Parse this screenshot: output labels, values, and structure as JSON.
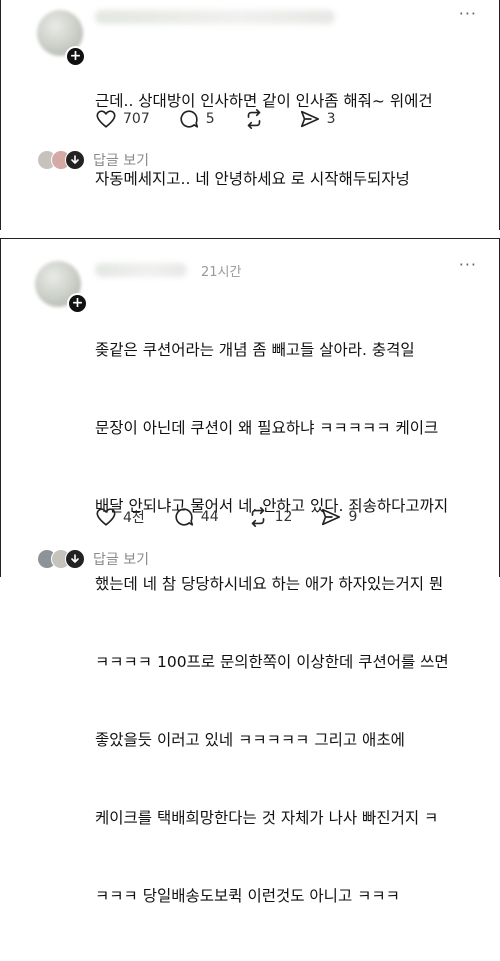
{
  "comments": [
    {
      "timestamp": "",
      "text_lines": [
        "근데.. 상대방이 인사하면 같이 인사좀 해줘~ 위에건",
        "자동메세지고.. 네 안녕하세요 로 시작해두되자넝"
      ],
      "likes": "707",
      "replies": "5",
      "reposts": "",
      "shares": "3",
      "reply_link": "답글 보기"
    },
    {
      "timestamp": "21시간",
      "text_lines": [
        "좆같은 쿠션어라는 개념 좀 빼고들 살아라. 충격일",
        "문장이 아닌데 쿠션이 왜 필요하냐 ㅋㅋㅋㅋㅋ 케이크",
        "배달 안되냐고 물어서 네. 안하고 있다. 죄송하다고까지",
        "했는데 네 참 당당하시네요 하는 애가 하자있는거지 뭔",
        "ㅋㅋㅋㅋ 100프로 문의한쪽이 이상한데 쿠션어를 쓰면",
        "좋았을듯 이러고 있네 ㅋㅋㅋㅋㅋ 그리고 애초에",
        "케이크를 택배희망한다는 것 자체가 나사 빠진거지 ㅋ",
        "ㅋㅋㅋ 당일배송도보퀵 이런것도 아니고 ㅋㅋㅋ"
      ],
      "likes": "4천",
      "replies": "44",
      "reposts": "12",
      "shares": "9",
      "reply_link": "답글 보기"
    }
  ],
  "icons": {
    "like": "heart-icon",
    "reply": "speech-bubble-icon",
    "repost": "repost-icon",
    "share": "send-icon",
    "follow": "plus-icon",
    "more": "more-dots-icon"
  }
}
